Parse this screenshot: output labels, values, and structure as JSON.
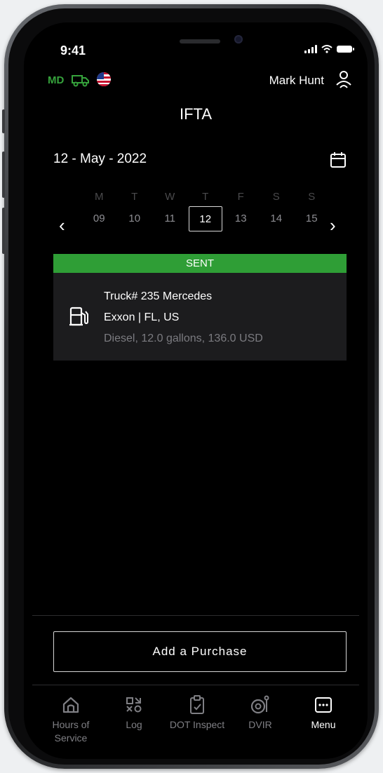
{
  "status_bar": {
    "time": "9:41"
  },
  "header": {
    "md_label": "MD",
    "user_name": "Mark Hunt",
    "title": "IFTA"
  },
  "date_selector": {
    "date_text": "12 - May - 2022",
    "prev_arrow": "‹",
    "next_arrow": "›",
    "days": [
      {
        "letter": "M",
        "num": "09"
      },
      {
        "letter": "T",
        "num": "10"
      },
      {
        "letter": "W",
        "num": "11"
      },
      {
        "letter": "T",
        "num": "12"
      },
      {
        "letter": "F",
        "num": "13"
      },
      {
        "letter": "S",
        "num": "14"
      },
      {
        "letter": "S",
        "num": "15"
      }
    ],
    "selected_index": 3
  },
  "purchase_card": {
    "status": "SENT",
    "line1": "Truck# 235 Mercedes",
    "line2": "Exxon | FL, US",
    "line3": "Diesel, 12.0 gallons, 136.0 USD",
    "status_color": "#2f9e36",
    "icon": "fuel-pump-icon"
  },
  "add_button_label": "Add a Purchase",
  "tabs": [
    {
      "label": "Hours of Service",
      "icon": "home-icon",
      "active": false
    },
    {
      "label": "Log",
      "icon": "log-icon",
      "active": false
    },
    {
      "label": "DOT Inspect",
      "icon": "clipboard-icon",
      "active": false
    },
    {
      "label": "DVIR",
      "icon": "dvir-icon",
      "active": false
    },
    {
      "label": "Menu",
      "icon": "menu-icon",
      "active": true
    }
  ],
  "colors": {
    "accent_green": "#2f9e36",
    "md_green": "#36a33c"
  }
}
